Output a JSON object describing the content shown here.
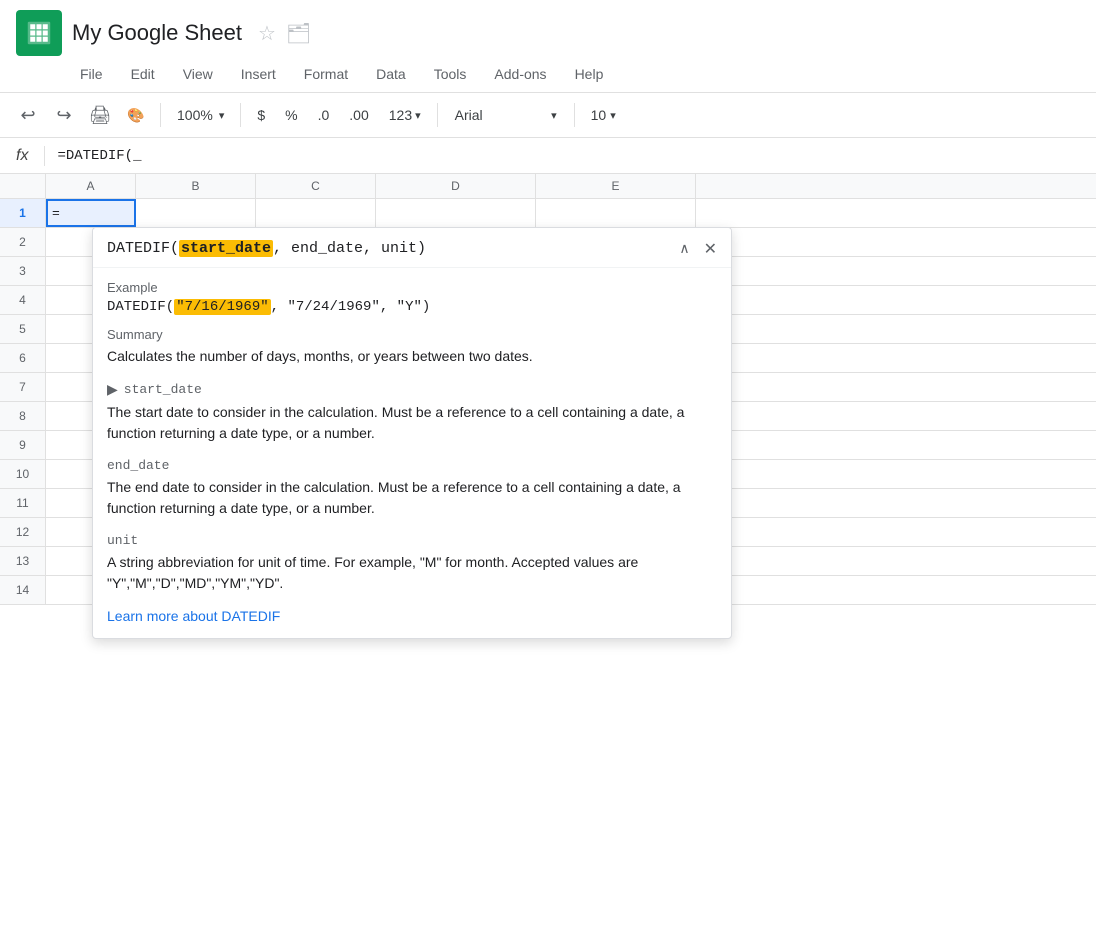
{
  "app": {
    "title": "My Google Sheet",
    "icon_alt": "Google Sheets logo"
  },
  "menu": {
    "items": [
      "File",
      "Edit",
      "View",
      "Insert",
      "Format",
      "Data",
      "Tools",
      "Add-ons",
      "Help"
    ]
  },
  "toolbar": {
    "zoom": "100%",
    "currency_symbol": "$",
    "percent_symbol": "%",
    "decimal_left": ".0",
    "decimal_right": ".00",
    "format_number": "123",
    "font_name": "Arial",
    "font_size": "10"
  },
  "formula_bar": {
    "fx_label": "fx",
    "formula": "=DATEDIF(_"
  },
  "columns": {
    "headers": [
      "",
      "A",
      "B",
      "C",
      "D",
      "E"
    ]
  },
  "rows": [
    {
      "num": "1"
    },
    {
      "num": "2"
    },
    {
      "num": "3"
    },
    {
      "num": "4"
    },
    {
      "num": "5"
    },
    {
      "num": "6"
    },
    {
      "num": "7"
    },
    {
      "num": "8"
    },
    {
      "num": "9"
    },
    {
      "num": "10"
    },
    {
      "num": "11"
    },
    {
      "num": "12"
    },
    {
      "num": "13"
    },
    {
      "num": "14"
    }
  ],
  "popup": {
    "title_prefix": "DATEDIF(",
    "param_highlighted": "start_date",
    "title_suffix": ", end_date, unit)",
    "example_label": "Example",
    "example_prefix": "DATEDIF(",
    "example_date_highlighted": "\"7/16/1969\"",
    "example_suffix": ", \"7/24/1969\", \"Y\")",
    "summary_label": "Summary",
    "summary_text": "Calculates the number of days, months, or years between two dates.",
    "param1_name": "start_date",
    "param1_arrow": "▶",
    "param1_desc": "The start date to consider in the calculation. Must be a reference to a cell containing a date, a function returning a date type, or a number.",
    "param2_name": "end_date",
    "param2_desc": "The end date to consider in the calculation. Must be a reference to a cell containing a date, a function returning a date type, or a number.",
    "param3_name": "unit",
    "param3_desc": "A string abbreviation for unit of time. For example, \"M\" for month. Accepted values are \"Y\",\"M\",\"D\",\"MD\",\"YM\",\"YD\".",
    "learn_more_text": "Learn more about DATEDIF"
  }
}
